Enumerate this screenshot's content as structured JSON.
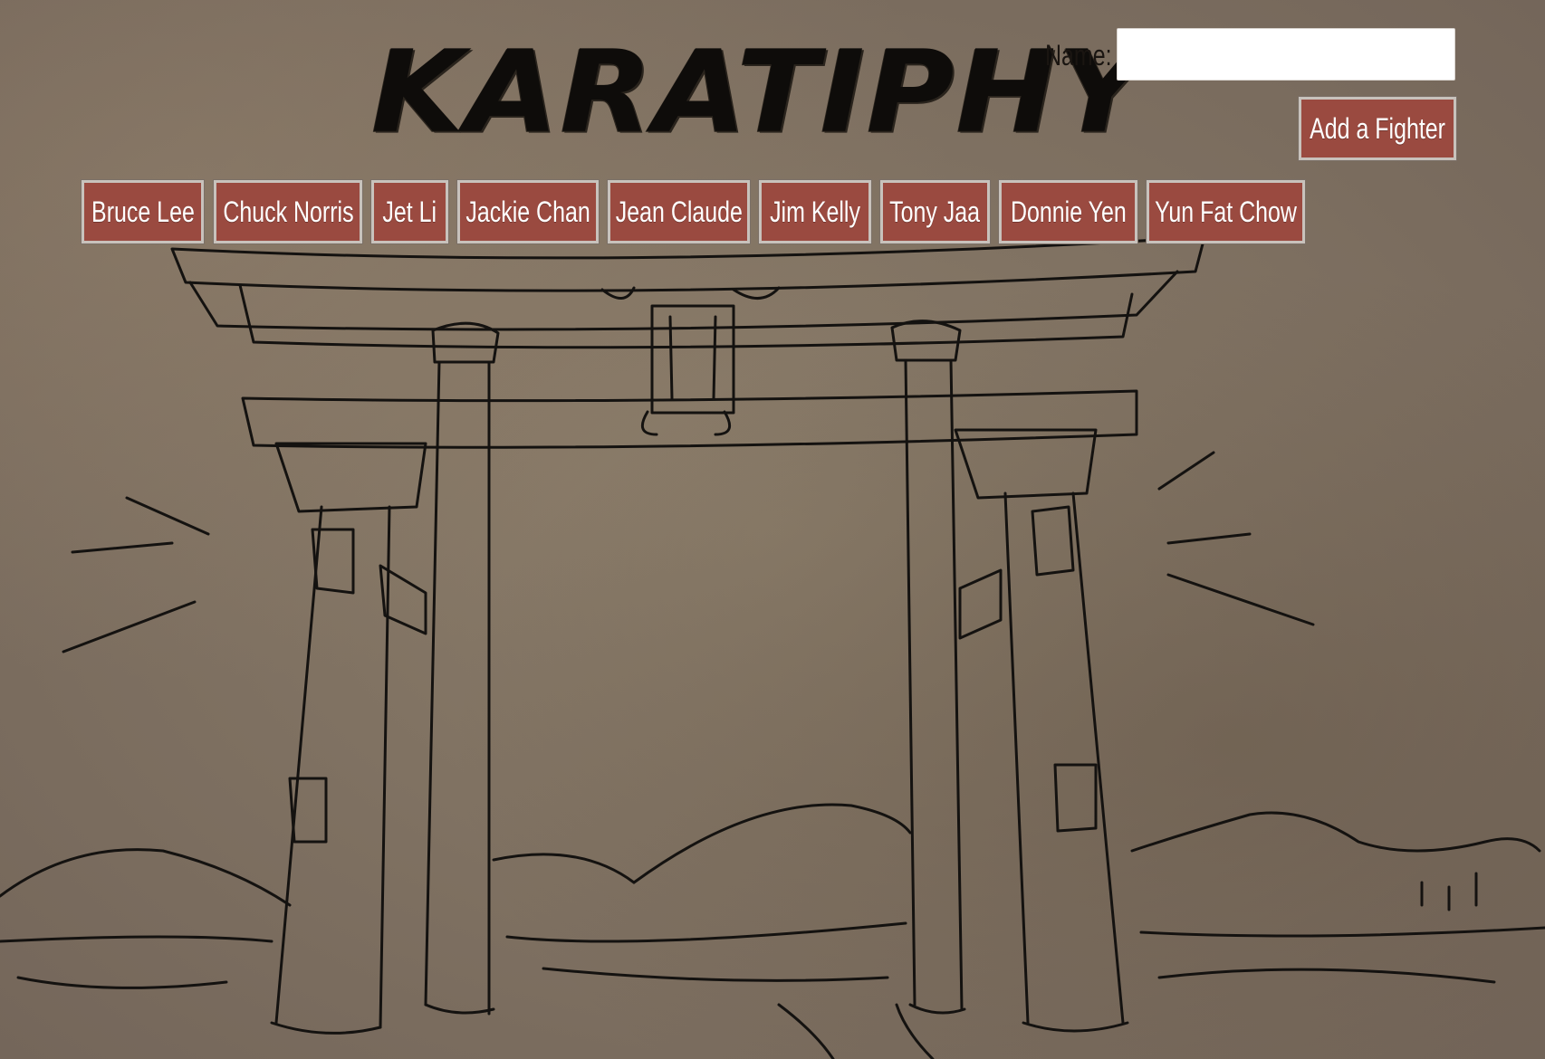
{
  "header": {
    "title": "KARATIPHY",
    "name_label": "Name:",
    "name_value": "",
    "add_button_label": "Add a Fighter"
  },
  "fighters": [
    {
      "label": "Bruce Lee"
    },
    {
      "label": "Chuck Norris"
    },
    {
      "label": "Jet Li"
    },
    {
      "label": "Jackie Chan"
    },
    {
      "label": "Jean Claude"
    },
    {
      "label": "Jim Kelly"
    },
    {
      "label": "Tony Jaa"
    },
    {
      "label": "Donnie Yen"
    },
    {
      "label": "Yun Fat Chow"
    }
  ],
  "colors": {
    "button_bg": "#9a4a40",
    "button_text": "#ffffff",
    "background": "#7d6f5d",
    "ink": "#0e0c0a"
  },
  "background_image": "torii-gate-sketch"
}
